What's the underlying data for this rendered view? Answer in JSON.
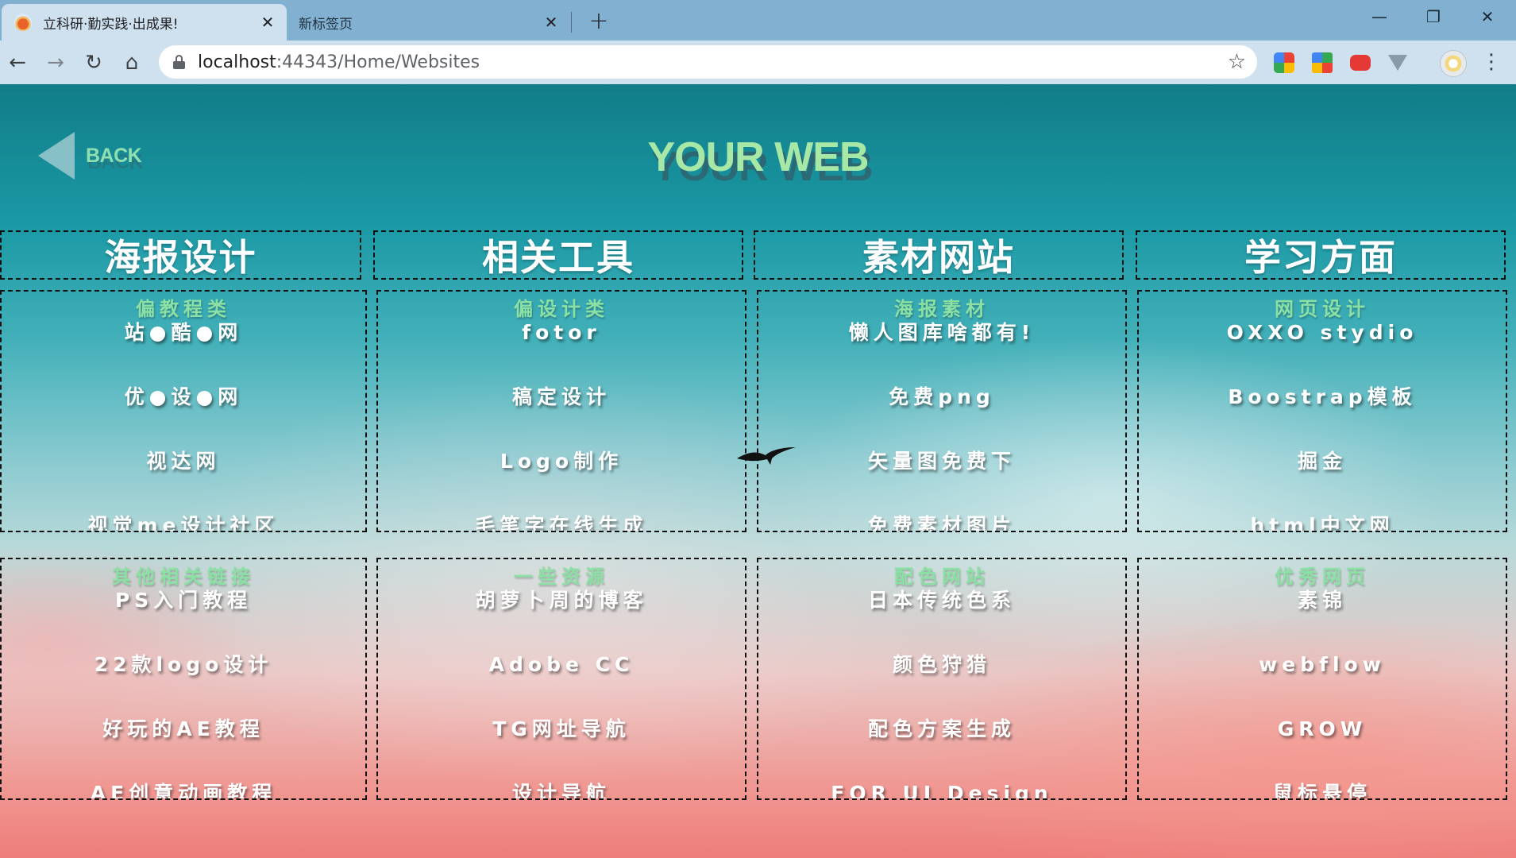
{
  "browser": {
    "tabs": [
      {
        "title": "立科研·勤实践·出成果!",
        "active": true
      },
      {
        "title": "新标签页",
        "active": false
      }
    ],
    "address": {
      "host": "localhost",
      "path": ":44343/Home/Websites"
    }
  },
  "page": {
    "back_label": "BACK",
    "title": "YOUR WEB",
    "columns": [
      {
        "heading": "海报设计",
        "groups": [
          {
            "subtitle": "偏教程类",
            "links": [
              "站●酷●网",
              "优●设●网",
              "视达网",
              "视觉me设计社区"
            ]
          },
          {
            "subtitle": "其他相关链接",
            "links": [
              "PS入门教程",
              "22款logo设计",
              "好玩的AE教程",
              "AE创意动画教程"
            ]
          }
        ]
      },
      {
        "heading": "相关工具",
        "groups": [
          {
            "subtitle": "偏设计类",
            "links": [
              "fotor",
              "稿定设计",
              "Logo制作",
              "毛笔字在线生成"
            ]
          },
          {
            "subtitle": "一些资源",
            "links": [
              "胡萝卜周的博客",
              "Adobe CC",
              "TG网址导航",
              "设计导航"
            ]
          }
        ]
      },
      {
        "heading": "素材网站",
        "groups": [
          {
            "subtitle": "海报素材",
            "links": [
              "懒人图库啥都有!",
              "免费png",
              "矢量图免费下",
              "免费素材图片"
            ]
          },
          {
            "subtitle": "配色网站",
            "links": [
              "日本传统色系",
              "颜色狩猎",
              "配色方案生成",
              "FOR UI Design"
            ]
          }
        ]
      },
      {
        "heading": "学习方面",
        "groups": [
          {
            "subtitle": "网页设计",
            "links": [
              "OXXO stydio",
              "Boostrap模板",
              "掘金",
              "html中文网"
            ]
          },
          {
            "subtitle": "优秀网页",
            "links": [
              "素锦",
              "webflow",
              "GROW",
              "鼠标悬停"
            ]
          }
        ]
      }
    ]
  }
}
